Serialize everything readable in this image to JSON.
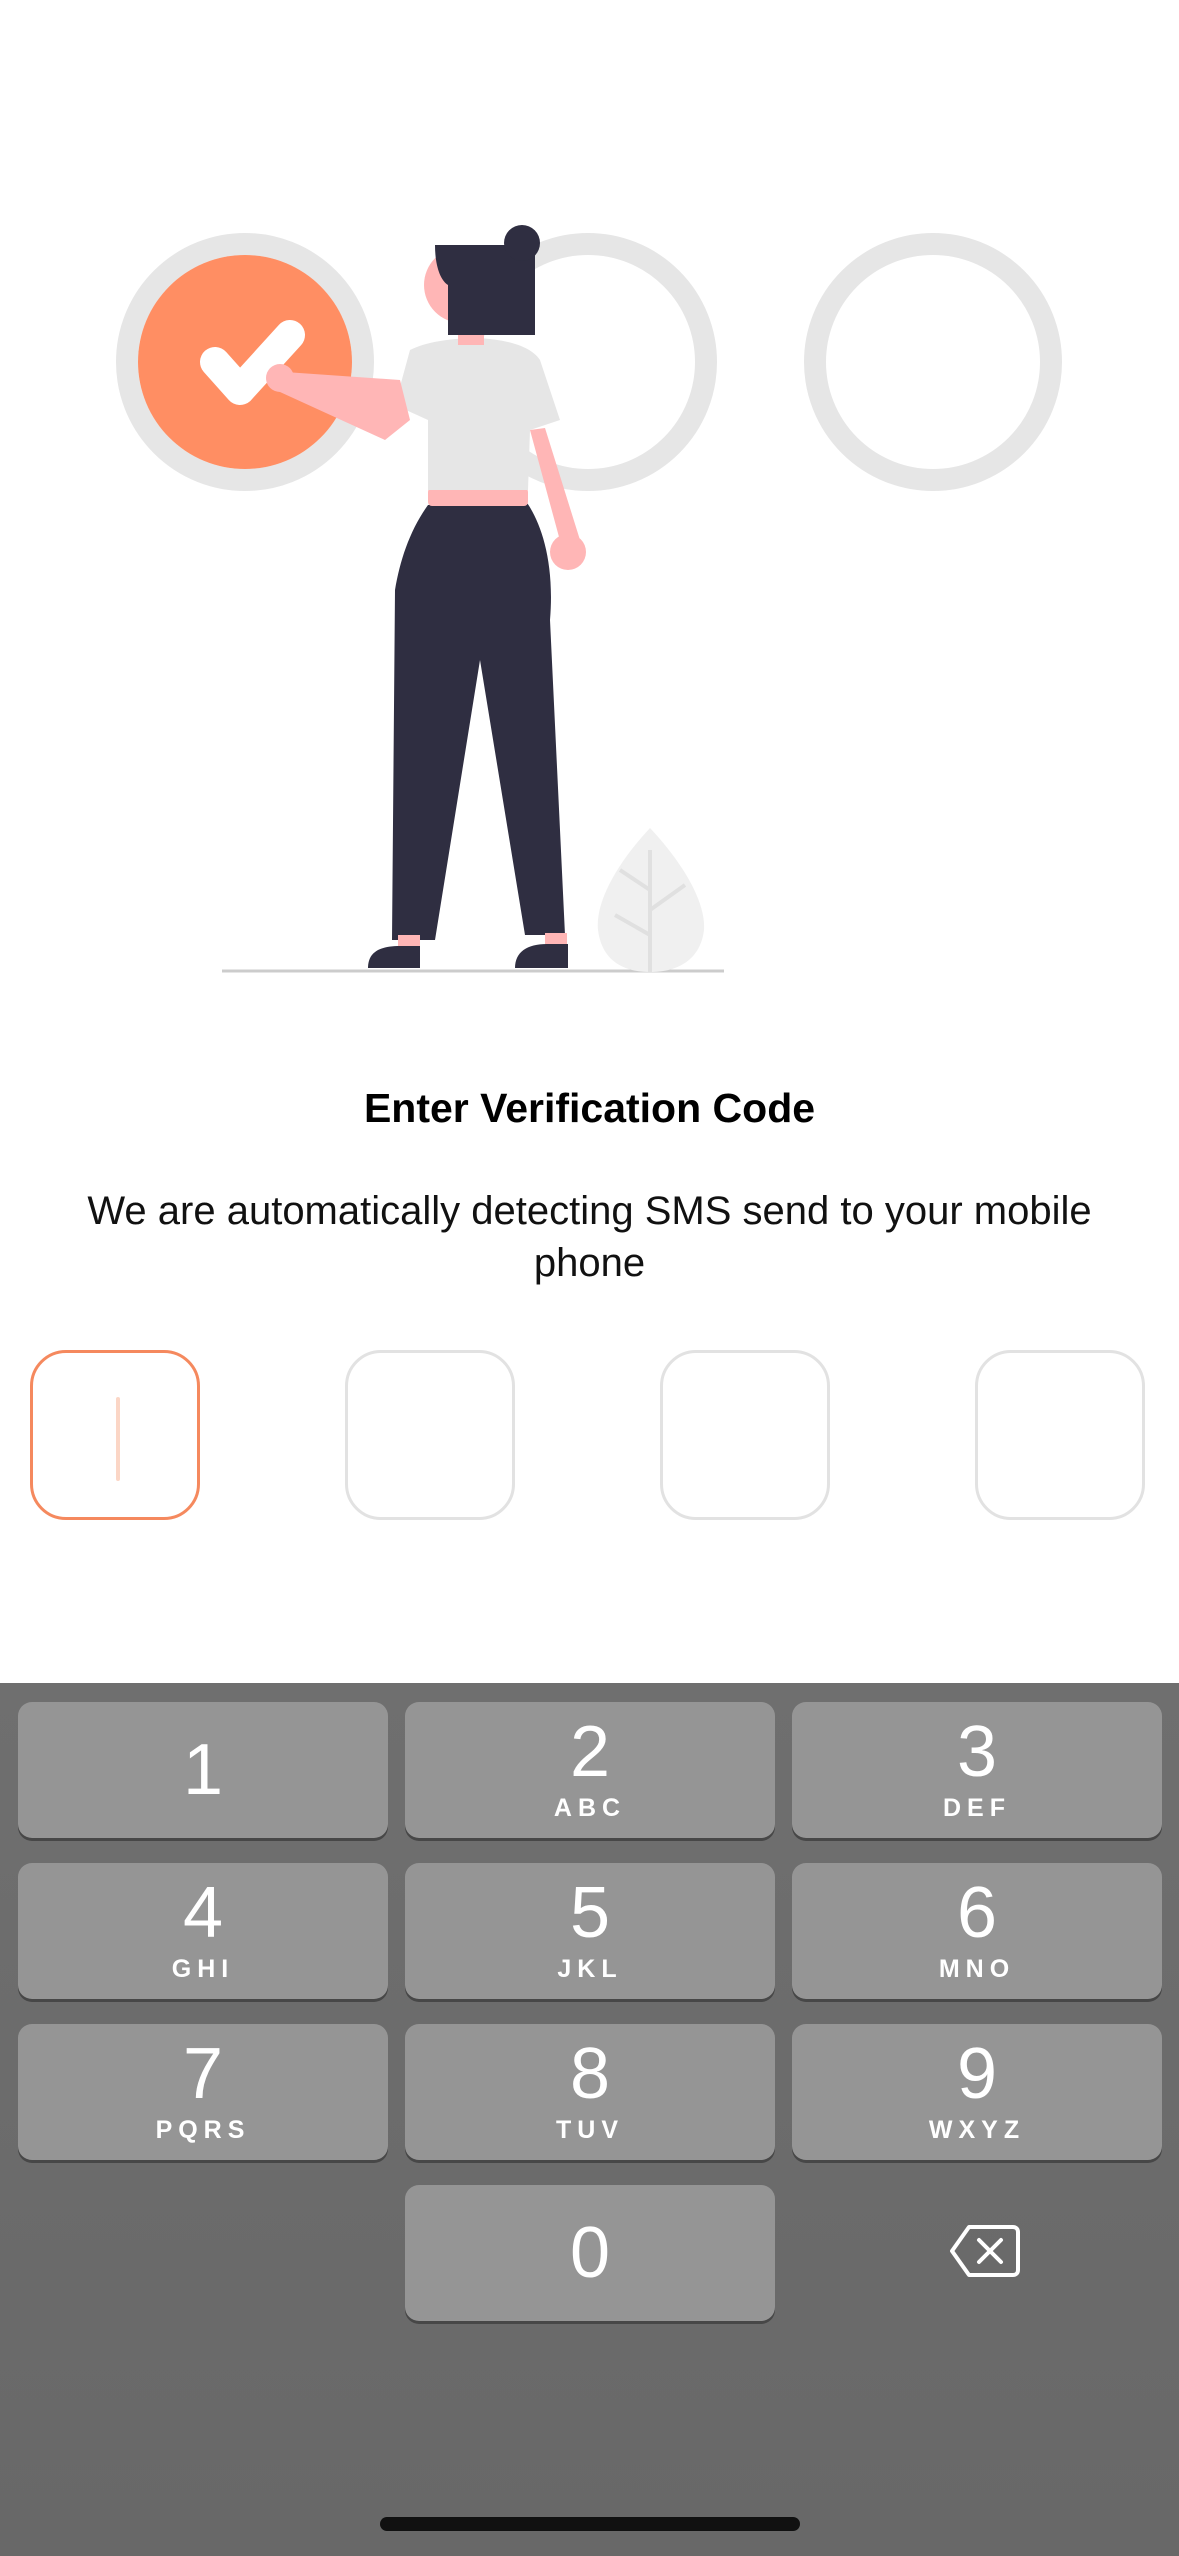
{
  "verification": {
    "title": "Enter Verification Code",
    "subtitle": "We are automatically detecting SMS send to your mobile phone"
  },
  "otp": {
    "length": 4,
    "active_index": 0,
    "values": [
      "",
      "",
      "",
      ""
    ]
  },
  "keypad": {
    "keys": [
      {
        "digit": "1",
        "letters": ""
      },
      {
        "digit": "2",
        "letters": "ABC"
      },
      {
        "digit": "3",
        "letters": "DEF"
      },
      {
        "digit": "4",
        "letters": "GHI"
      },
      {
        "digit": "5",
        "letters": "JKL"
      },
      {
        "digit": "6",
        "letters": "MNO"
      },
      {
        "digit": "7",
        "letters": "PQRS"
      },
      {
        "digit": "8",
        "letters": "TUV"
      },
      {
        "digit": "9",
        "letters": "WXYZ"
      },
      {
        "digit": "0",
        "letters": ""
      }
    ],
    "backspace_icon": "delete-left-icon"
  },
  "colors": {
    "accent": "#F5895E",
    "step_inactive": "#E6E6E6",
    "figure_dark": "#2F2E41",
    "skin": "#FFB6B6",
    "keyboard_bg": "#6B6B6B",
    "key_bg": "#959595"
  },
  "illustration": {
    "steps_total": 3,
    "steps_completed": 1,
    "icons": [
      "checkmark-icon",
      "person-illustration",
      "leaf-plant-icon"
    ]
  }
}
